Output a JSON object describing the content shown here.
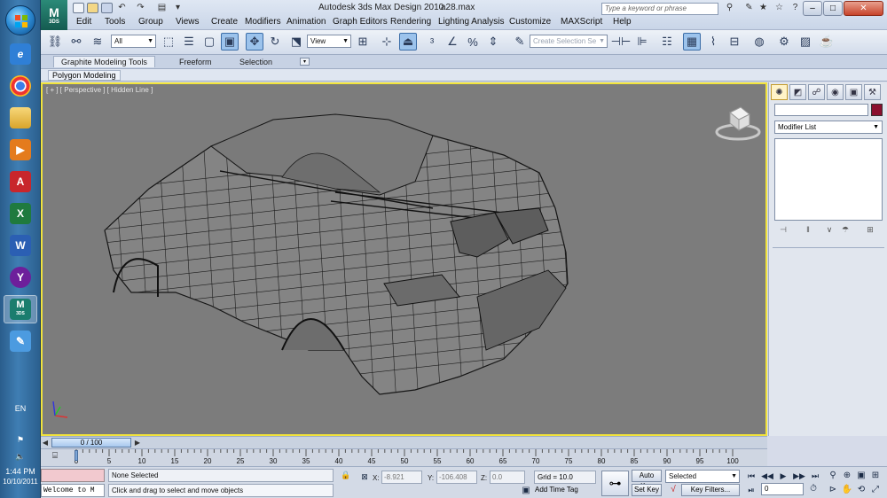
{
  "window": {
    "title": "Autodesk 3ds Max Design 2010",
    "file": "a28.max",
    "search_placeholder": "Type a keyword or phrase",
    "logo_text": "3DS"
  },
  "menu": [
    "Edit",
    "Tools",
    "Group",
    "Views",
    "Create",
    "Modifiers",
    "Animation",
    "Graph Editors",
    "Rendering",
    "Lighting Analysis",
    "Customize",
    "MAXScript",
    "Help"
  ],
  "toolbar": {
    "selection_filter": "All",
    "reference_coord": "View",
    "named_selection_placeholder": "Create Selection Se"
  },
  "ribbon": {
    "tabs": [
      "Graphite Modeling Tools",
      "Freeform",
      "Selection"
    ],
    "active_tab": "Graphite Modeling Tools",
    "subpanel": "Polygon Modeling"
  },
  "viewport": {
    "label": "[ + ] [ Perspective ] [ Hidden Line ]",
    "border_color": "#f1e33c",
    "background": "#7c7c7c"
  },
  "command_panel": {
    "modifier_list": "Modifier List",
    "object_color": "#8a0f2e"
  },
  "time": {
    "slider_label": "0 / 100",
    "current_frame": 0,
    "start": 0,
    "end": 100,
    "tick_labels": [
      "0",
      "5",
      "10",
      "15",
      "20",
      "25",
      "30",
      "35",
      "40",
      "45",
      "50",
      "55",
      "60",
      "65",
      "70",
      "75",
      "80",
      "85",
      "90",
      "95",
      "100"
    ]
  },
  "status": {
    "selection": "None Selected",
    "prompt": "Click and drag to select and move objects",
    "listener_text": "Welcome to M",
    "x_label": "X:",
    "x_value": "-8.921",
    "y_label": "Y:",
    "y_value": "-106.408",
    "z_label": "Z:",
    "z_value": "0.0",
    "grid": "Grid = 10.0",
    "add_time_tag": "Add Time Tag",
    "auto_key": "Auto Key",
    "set_key": "Set Key",
    "key_mode": "Selected",
    "key_filters": "Key Filters...",
    "frame_value": "0"
  },
  "taskbar": {
    "language": "EN",
    "time": "1:44 PM",
    "date": "10/10/2011",
    "app_3ds_label": "3DS"
  }
}
